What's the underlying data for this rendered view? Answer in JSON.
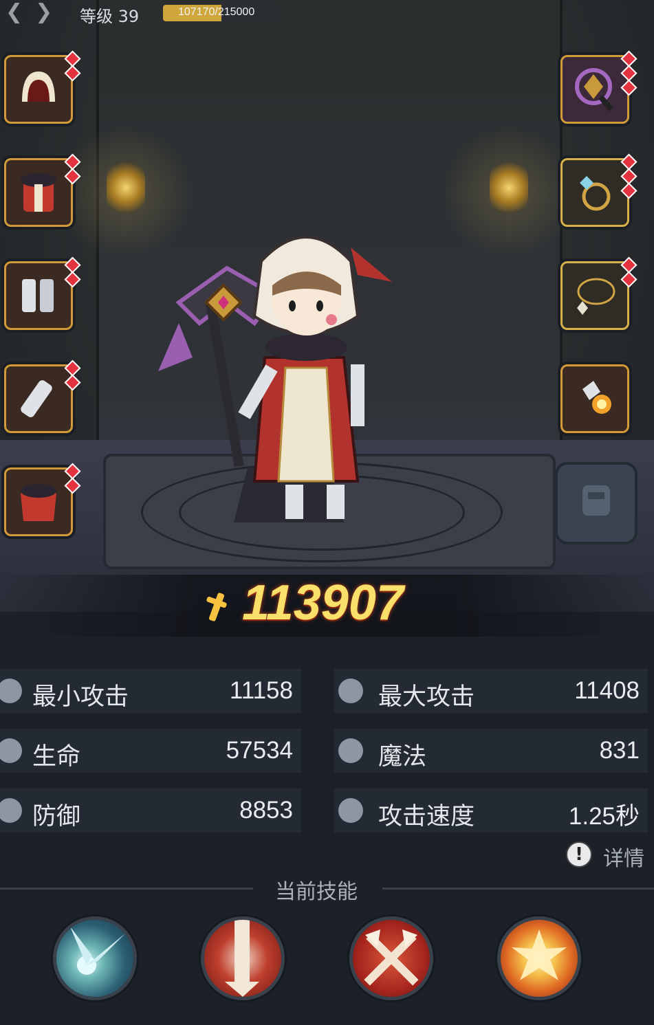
{
  "header": {
    "back_icon": "double-chevron-back-icon",
    "level_text": "等级 39",
    "xp_text": "107170/215000",
    "xp_current": 107170,
    "xp_max": 215000
  },
  "equipment": {
    "left": [
      {
        "name": "hood",
        "gems": 2
      },
      {
        "name": "robe",
        "gems": 2
      },
      {
        "name": "boots",
        "gems": 2
      },
      {
        "name": "bracer",
        "gems": 2
      },
      {
        "name": "cape",
        "gems": 2
      }
    ],
    "right": [
      {
        "name": "axe-staff",
        "gems": 3
      },
      {
        "name": "ring",
        "gems": 3
      },
      {
        "name": "necklace",
        "gems": 2
      },
      {
        "name": "flame-charm",
        "gems": 0
      }
    ]
  },
  "power": {
    "icon": "sword-power-icon",
    "value": "113907"
  },
  "stats": {
    "min_attack": {
      "label": "最小攻击",
      "value": "11158"
    },
    "max_attack": {
      "label": "最大攻击",
      "value": "11408"
    },
    "hp": {
      "label": "生命",
      "value": "57534"
    },
    "mana": {
      "label": "魔法",
      "value": "831"
    },
    "defense": {
      "label": "防御",
      "value": "8853"
    },
    "attack_speed": {
      "label": "攻击速度",
      "value": "1.25秒"
    }
  },
  "details": {
    "icon": "exclamation-icon",
    "label": "详情"
  },
  "skills": {
    "header": "当前技能",
    "items": [
      {
        "name": "ice-burst"
      },
      {
        "name": "holy-strike"
      },
      {
        "name": "crossed-axes"
      },
      {
        "name": "fire-explosion"
      }
    ]
  },
  "colors": {
    "power_text": "#f8e06a",
    "slot_border": "#d39a38",
    "gem": "#e4333f"
  }
}
